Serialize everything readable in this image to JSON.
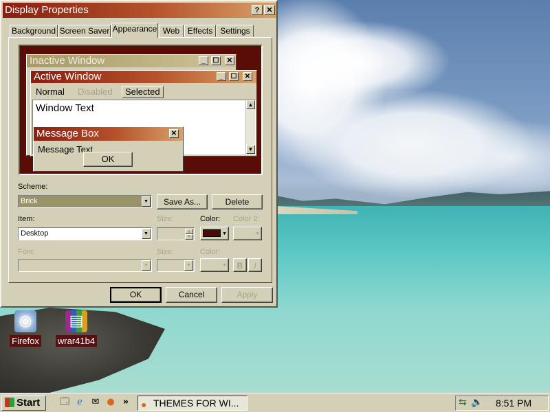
{
  "dialog": {
    "title": "Display Properties",
    "help_button": "?",
    "close_button": "✕",
    "tabs": [
      "Background",
      "Screen Saver",
      "Appearance",
      "Web",
      "Effects",
      "Settings"
    ],
    "active_tab": "Appearance"
  },
  "preview": {
    "inactive_title": "Inactive Window",
    "active_title": "Active Window",
    "menu": {
      "normal": "Normal",
      "disabled": "Disabled",
      "selected": "Selected"
    },
    "window_text": "Window Text",
    "message_box_title": "Message Box",
    "message_text": "Message Text",
    "ok": "OK"
  },
  "scheme": {
    "label": "Scheme:",
    "value": "Brick",
    "save_as": "Save As...",
    "delete": "Delete"
  },
  "item": {
    "label": "Item:",
    "value": "Desktop",
    "size_label": "Size:",
    "color_label": "Color:",
    "color2_label": "Color 2:",
    "color_value": "#4a0a06"
  },
  "font": {
    "label": "Font:",
    "size_label": "Size:",
    "color_label": "Color:",
    "bold": "B",
    "italic": "I"
  },
  "buttons": {
    "ok": "OK",
    "cancel": "Cancel",
    "apply": "Apply"
  },
  "desktop_icons": [
    {
      "label": "Firefox"
    },
    {
      "label": "wrar41b4"
    }
  ],
  "taskbar": {
    "start": "Start",
    "overflow": "»",
    "task": "THEMES FOR WI...",
    "clock": "8:51 PM"
  }
}
